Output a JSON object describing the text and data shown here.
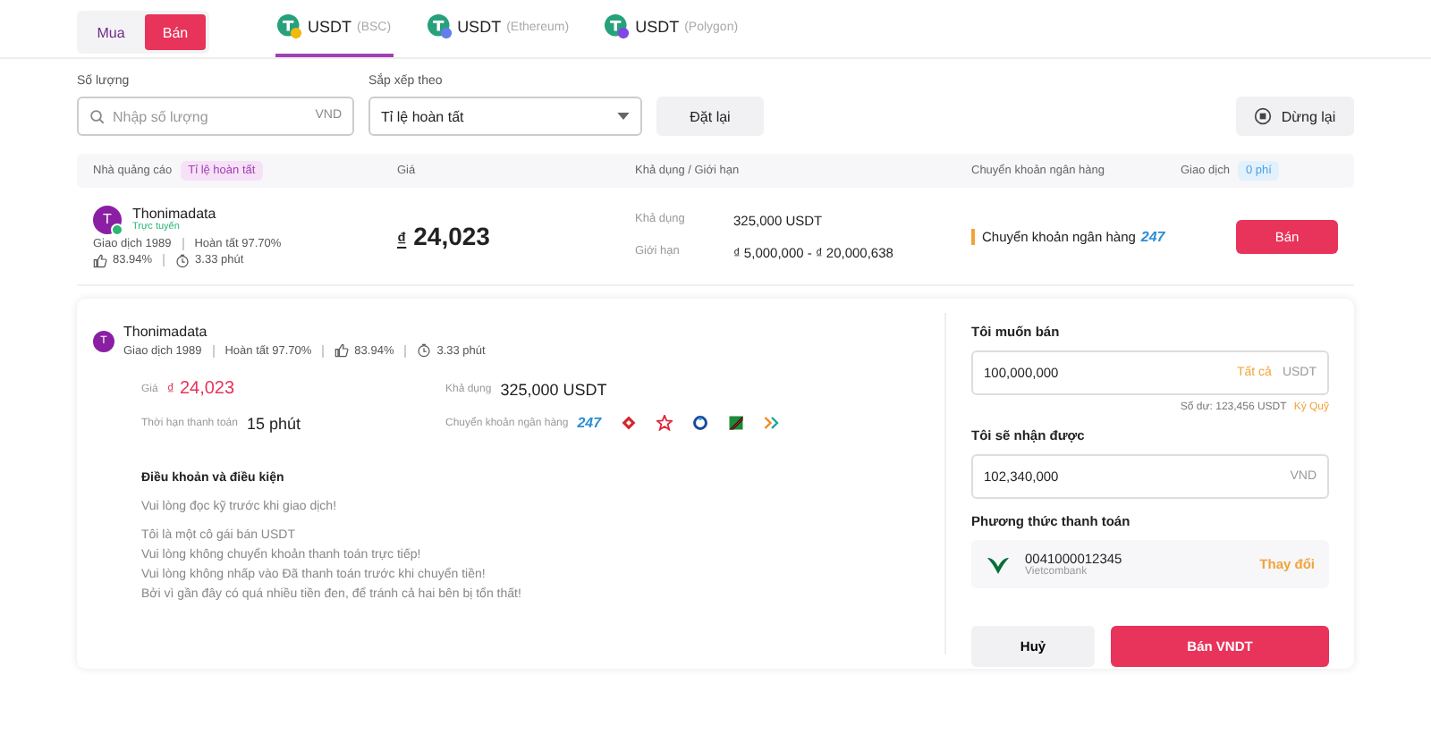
{
  "trade_side": [
    {
      "label": "Mua",
      "selected": false
    },
    {
      "label": "Bán",
      "selected": true
    }
  ],
  "networks": [
    {
      "token": "USDT",
      "network": "(BSC)",
      "color": "#f0b90b",
      "selected": true
    },
    {
      "token": "USDT",
      "network": "(Ethereum)",
      "color": "#627eea",
      "selected": false
    },
    {
      "token": "USDT",
      "network": "(Polygon)",
      "color": "#8247e5",
      "selected": false
    }
  ],
  "filters": {
    "quantity": {
      "label": "Số lượng",
      "placeholder": "Nhập số lượng",
      "unit": "VND"
    },
    "sort": {
      "label": "Sắp xếp theo",
      "value": "Tỉ lệ hoàn tất"
    },
    "reset_button": "Đặt lại",
    "stop_button": "Dừng lại"
  },
  "table": {
    "columns": [
      {
        "label": "Nhà quảng cáo",
        "badge": "Tỉ lệ hoàn tất",
        "color": "#f6e1f7"
      },
      {
        "label": "Giá"
      },
      {
        "label": "Khả dụng / Giới hạn"
      },
      {
        "label": "Chuyển khoản ngân hàng"
      },
      {
        "label": "Giao dịch",
        "badge": "0 phí",
        "color": "#e3f1fd"
      }
    ],
    "rows": [
      {
        "avatar": "T",
        "name": "Thonimadata",
        "online": true,
        "status": "Trực tuyến",
        "trades": "Giao dịch 1989",
        "completion": "Hoàn tất 97.70%",
        "rating": "83.94%",
        "time": "3.33 phút",
        "currency": "₫",
        "price": "24,023",
        "available_label": "Khả dụng",
        "available": "325,000 USDT",
        "limit_label": "Giới hạn",
        "limit": "₫ 5,000,000 - ₫ 20,000,638",
        "payment": "Chuyển khoản ngân hàng",
        "payment_badge": "247",
        "action": "Bán"
      }
    ]
  },
  "detail": {
    "avatar": "T",
    "name": "Thonimadata",
    "trades": "Giao dịch 1989",
    "completion": "Hoàn tất 97.70%",
    "rating": "83.94%",
    "time": "3.33 phút",
    "price_label": "Giá",
    "currency": "₫",
    "price": "24,023",
    "payment_time_label": "Thời hạn thanh toán",
    "payment_time": "15 phút",
    "available_label": "Khả dụng",
    "available": "325,000 USDT",
    "bank_label": "Chuyển khoản ngân hàng",
    "bank_badge": "247",
    "terms_title": "Điều khoản và điều kiện",
    "terms": [
      [
        "Vui lòng đọc kỹ trước khi giao dịch!"
      ],
      [
        "Tôi là một cô gái bán USDT",
        "Vui lòng không chuyển khoản thanh toán trực tiếp!",
        "Vui lòng không nhấp vào Đã thanh toán trước khi chuyển tiền!",
        "Bởi vì gần đây có quá nhiều tiền đen, để tránh cả hai bên bị tổn thất!"
      ]
    ]
  },
  "order": {
    "sell_label": "Tôi muốn bán",
    "sell_value": "100,000,000",
    "all_link": "Tất cả",
    "sell_unit": "USDT",
    "balance": "Số dư: 123,456  USDT",
    "escrow_link": "Ký Quỹ",
    "receive_label": "Tôi sẽ nhận được",
    "receive_value": "102,340,000",
    "receive_unit": "VND",
    "method_label": "Phương thức thanh toán",
    "account": "0041000012345",
    "bank": "Vietcombank",
    "change_link": "Thay đổi",
    "cancel_button": "Huỷ",
    "submit_button": "Bán VNDT"
  }
}
